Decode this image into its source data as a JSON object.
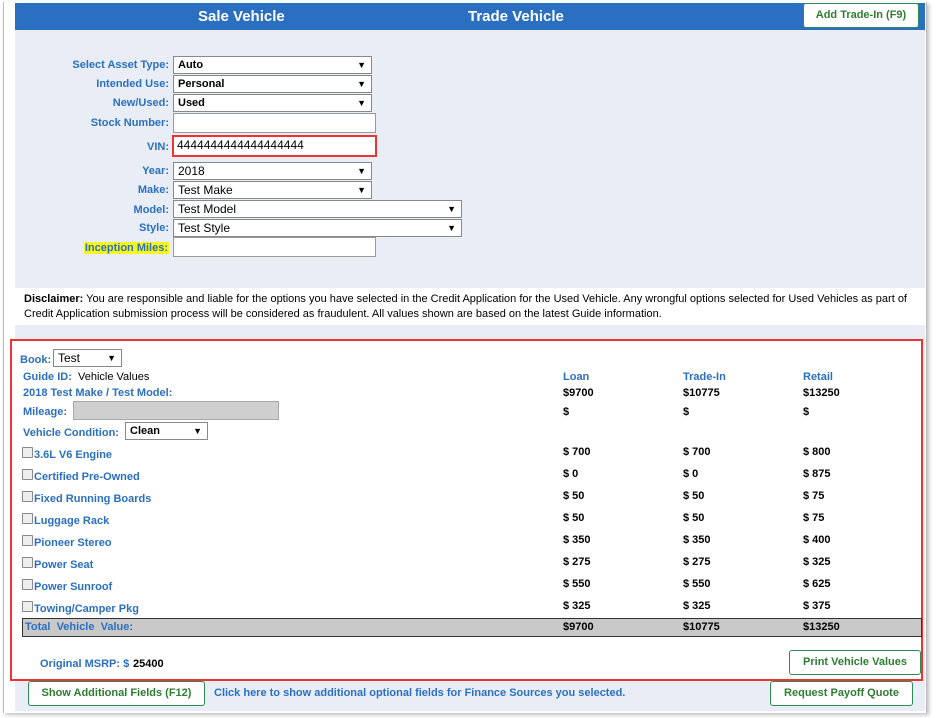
{
  "header": {
    "tab_sale": "Sale Vehicle",
    "tab_trade": "Trade Vehicle",
    "add_trade_in_button": "Add Trade-In (F9)"
  },
  "form": {
    "asset_type": {
      "label": "Select Asset Type:",
      "value": "Auto"
    },
    "intended_use": {
      "label": "Intended Use:",
      "value": "Personal"
    },
    "new_used": {
      "label": "New/Used:",
      "value": "Used"
    },
    "stock_number": {
      "label": "Stock Number:",
      "value": ""
    },
    "vin": {
      "label": "VIN:",
      "value": "4444444444444444444"
    },
    "year": {
      "label": "Year:",
      "value": "2018"
    },
    "make": {
      "label": "Make:",
      "value": "Test Make"
    },
    "model": {
      "label": "Model:",
      "value": "Test Model"
    },
    "style": {
      "label": "Style:",
      "value": "Test Style"
    },
    "inception_miles": {
      "label": "Inception Miles:",
      "value": ""
    }
  },
  "disclaimer": {
    "heading": "Disclaimer:",
    "text": " You are responsible and liable for the options you have selected in the Credit Application for the Used Vehicle. Any wrongful options selected for Used Vehicles as part of Credit Application submission process will be considered as fraudulent. All values shown are based on the latest Guide information."
  },
  "book": {
    "label": "Book:",
    "value": "Test",
    "guide_id_label": "Guide ID:",
    "guide_id_value": "Vehicle Values",
    "vehicle_name": "2018 Test Make / Test Model:",
    "mileage_label": "Mileage:",
    "condition_label": "Vehicle Condition:",
    "condition_value": "Clean",
    "columns": [
      "Loan",
      "Trade-In",
      "Retail"
    ],
    "base_values": [
      "$9700",
      "$10775",
      "$13250"
    ],
    "mileage_values": [
      "$",
      "$",
      "$"
    ],
    "options": [
      {
        "name": "3.6L V6 Engine",
        "values": [
          "$ 700",
          "$ 700",
          "$ 800"
        ]
      },
      {
        "name": "Certified Pre-Owned",
        "values": [
          "$ 0",
          "$ 0",
          "$ 875"
        ]
      },
      {
        "name": "Fixed Running Boards",
        "values": [
          "$ 50",
          "$ 50",
          "$ 75"
        ]
      },
      {
        "name": "Luggage Rack",
        "values": [
          "$ 50",
          "$ 50",
          "$ 75"
        ]
      },
      {
        "name": "Pioneer Stereo",
        "values": [
          "$ 350",
          "$ 350",
          "$ 400"
        ]
      },
      {
        "name": "Power Seat",
        "values": [
          "$ 275",
          "$ 275",
          "$ 325"
        ]
      },
      {
        "name": "Power Sunroof",
        "values": [
          "$ 550",
          "$ 550",
          "$ 625"
        ]
      },
      {
        "name": "Towing/Camper Pkg",
        "values": [
          "$ 325",
          "$ 325",
          "$ 375"
        ]
      }
    ],
    "total_label": "Total  Vehicle  Value:",
    "total_values": [
      "$9700",
      "$10775",
      "$13250"
    ],
    "msrp_label": "Original MSRP: $",
    "msrp_value": "25400",
    "print_button": "Print Vehicle Values"
  },
  "footer": {
    "additional_fields_button": "Show Additional Fields (F12)",
    "additional_fields_link": "Click here to show additional optional fields for Finance Sources you selected.",
    "payoff_button": "Request Payoff Quote"
  },
  "colors": {
    "accent_blue": "#2b6fc0",
    "button_green": "#2e7d32",
    "highlight_red": "#ee3333",
    "highlight_yellow": "#f7f71a",
    "panel_bg": "#e9eef6"
  }
}
